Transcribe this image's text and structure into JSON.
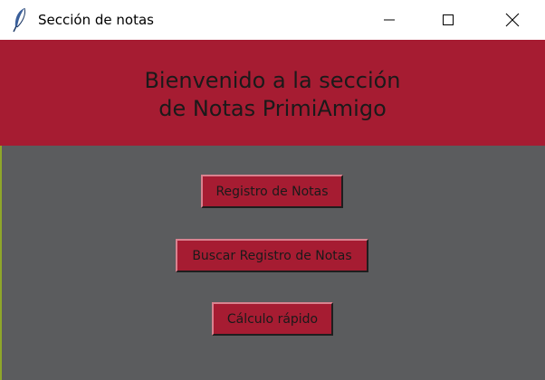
{
  "window": {
    "title": "Sección de notas",
    "app_icon": "feather-icon",
    "controls": {
      "minimize_icon": "minimize-icon",
      "maximize_icon": "maximize-icon",
      "close_icon": "close-icon"
    }
  },
  "header": {
    "line1": "Bienvenido a la sección",
    "line2": "de Notas PrimiAmigo"
  },
  "buttons": [
    {
      "label": "Registro de Notas"
    },
    {
      "label": "Buscar Registro de Notas"
    },
    {
      "label": "Cálculo rápido"
    }
  ],
  "colors": {
    "banner": "#a61c32",
    "button": "#a61c32",
    "background": "#5b5c5e",
    "titlebar": "#ffffff"
  }
}
